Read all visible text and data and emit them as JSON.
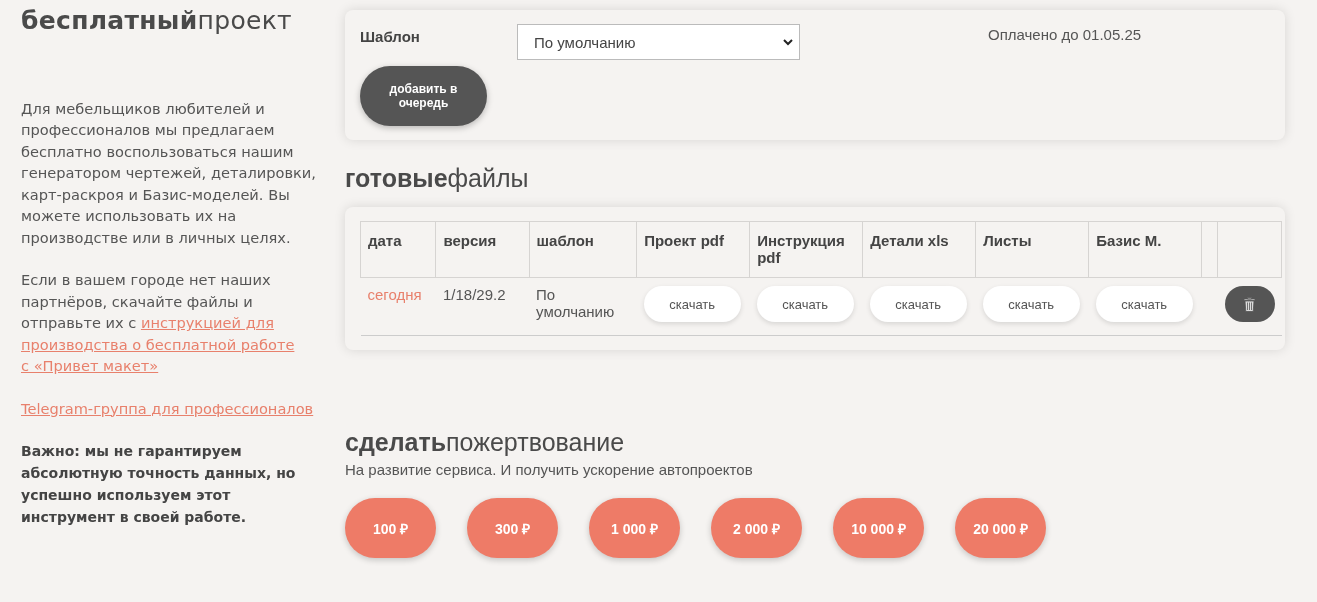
{
  "sidebar": {
    "title": "**бесплатный**проект",
    "intro": "Для мебельщиков любителей и профессионалов мы предлагаем бесплатно воспользоваться нашим генератором чертежей, деталировки, карт-раскроя и Базис-моделей. Вы можете использовать их на производстве или в личных целях.",
    "partners_text": [
      "Если в вашем городе нет наших партнёров, скачайте файлы и",
      "отправьте их с"
    ],
    "partners_link": [
      "инструкцией для",
      "производства о бесплатной работе",
      "с «Привет макет»"
    ],
    "telegram_link": "Telegram-группа для профессионалов",
    "warning": "Важно: мы не гарантируем абсолютную точность данных, но успешно используем этот инструмент в своей работе."
  },
  "settings": {
    "template_label": "Шаблон",
    "template_value": "По умолчанию",
    "paid_until": "Оплачено до 01.05.25",
    "add_button": "добавить в очередь"
  },
  "files": {
    "title": "**готовые**файлы",
    "columns": [
      "дата",
      "версия",
      "шаблон",
      "Проект pdf",
      "Инструкция pdf",
      "Детали xls",
      "Листы",
      "Базис М."
    ],
    "rows": [
      {
        "date": "сегодня",
        "version": "1/18/29.2",
        "template": "По умолчанию",
        "downloads": [
          "скачать",
          "скачать",
          "скачать",
          "скачать",
          "скачать"
        ]
      }
    ]
  },
  "donate": {
    "title": "**сделать**пожертвование",
    "subtitle": "На развитие сервиса. И получить ускорение автопроектов",
    "amounts": [
      "100 ₽",
      "300 ₽",
      "1 000 ₽",
      "2 000 ₽",
      "10 000 ₽",
      "20 000 ₽"
    ]
  }
}
